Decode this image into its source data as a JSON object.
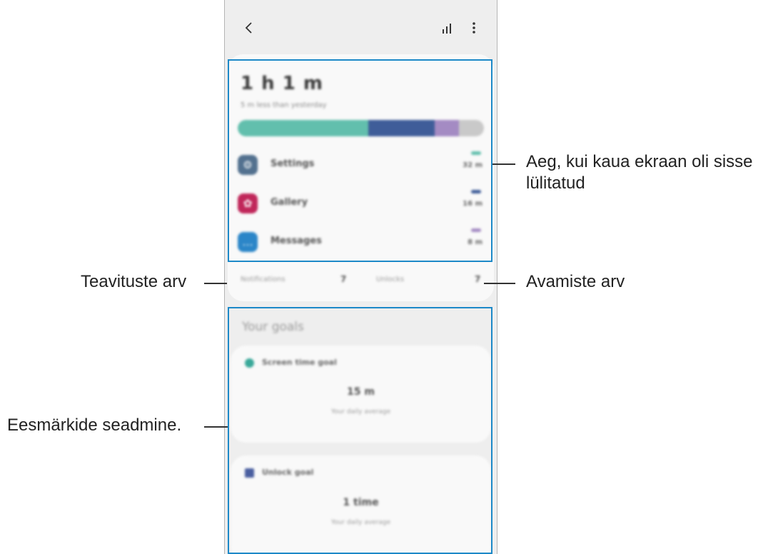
{
  "header": {
    "back_icon": "chevron-left-icon",
    "stats_icon": "bar-chart-icon",
    "more_icon": "more-vertical-icon"
  },
  "usage": {
    "total": "1 h 1 m",
    "subtitle": "5 m less than yesterday",
    "bar_segments": [
      {
        "color": "#62bfad",
        "fraction": 0.53
      },
      {
        "color": "#3f5d99",
        "fraction": 0.27
      },
      {
        "color": "#a48bc3",
        "fraction": 0.1
      },
      {
        "color": "#c9c9c9",
        "fraction": 0.1
      }
    ],
    "apps": [
      {
        "name": "Settings",
        "time": "32 m",
        "icon": "gear-icon",
        "icon_color": "#53718f",
        "tick_color": "#62bfad"
      },
      {
        "name": "Gallery",
        "time": "16 m",
        "icon": "flower-icon",
        "icon_color": "#c0275a",
        "tick_color": "#3f5d99"
      },
      {
        "name": "Messages",
        "time": "8 m",
        "icon": "chat-bubble-icon",
        "icon_color": "#2b86c8",
        "tick_color": "#a48bc3"
      }
    ]
  },
  "counts": {
    "notifications_label": "Notifications",
    "notifications_value": "7",
    "unlocks_label": "Unlocks",
    "unlocks_value": "7"
  },
  "goals": {
    "title": "Your goals",
    "screen_time": {
      "name": "Screen time goal",
      "value": "15 m",
      "sub": "Your daily average",
      "icon_color": "#3aa99a"
    },
    "unlock": {
      "name": "Unlock goal",
      "value": "1 time",
      "sub": "Your daily average",
      "icon_color": "#4a5fa0"
    }
  },
  "callouts": {
    "screen_time_line1": "Aeg, kui kaua ekraan oli sisse",
    "screen_time_line2": "lülitatud",
    "notifications": "Teavituste arv",
    "unlocks": "Avamiste arv",
    "goals": "Eesmärkide seadmine."
  }
}
